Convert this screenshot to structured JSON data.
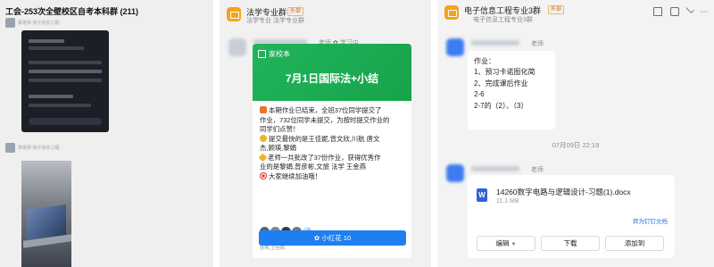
{
  "panel1": {
    "chat_title": "工会-253次全壁校区自考本科群 (211)",
    "sender1_name": "蔡老师 电子信息工程",
    "sender2_name": "李老师 电子信息工程"
  },
  "panel2": {
    "group_name": "法学专业群",
    "ext_tag": "外部",
    "sub_line": "法学专业 法学专业群",
    "teacher_role": "老师",
    "source_label": "学习中",
    "card": {
      "banner_app": "家校本",
      "banner_title": "7月1日国际法+小结",
      "lines": [
        "本期作业已结束，全班37位同学提交了",
        "作业，732位同学未提交，为按时提交作业的",
        "同学们点赞！",
        "提交最快的是王佳妮,曾文欣,川航  唐文",
        "杰,顾瑛,黎娟",
        "老师一共批改了37份作业，获得优秀作",
        "业的是黎娟,曾彦彬,文旅 法学 王金燕",
        "大家继续加油哦！"
      ],
      "avatar_more": "+7",
      "readers": "杨欣,西部苏福瑞,已草,王珊珊,钱佳超,曾真巴登,唐子键,文琼 陶朗婷,曾彦彬,王佳妮",
      "flower_button": "小红花 10"
    }
  },
  "panel3": {
    "group_name": "电子信息工程专业3群",
    "ext_tag": "外部",
    "sub_line": "电子信息工程专业3群",
    "toolbar_icons": [
      "home-icon",
      "video-icon",
      "check-icon",
      "more-icon"
    ],
    "teacher_role": "老师",
    "homework_lines": [
      "作业：",
      "1、预习卡诺图化简",
      "2、完成课后作业",
      "2-6",
      "2-7的（2）、（3）"
    ],
    "time_separator": "07月09日 22:19",
    "file": {
      "name": "14260数字电路与逻辑设计-习题(1).docx",
      "size": "11.1 MB",
      "save_link": "转为钉钉文档",
      "edit_button": "编辑",
      "download_button": "下载",
      "add_button": "添加到"
    }
  },
  "colors": {
    "accent_blue": "#1f7ef0",
    "banner_green": "#21b45b",
    "app_orange": "#f7a21b"
  }
}
